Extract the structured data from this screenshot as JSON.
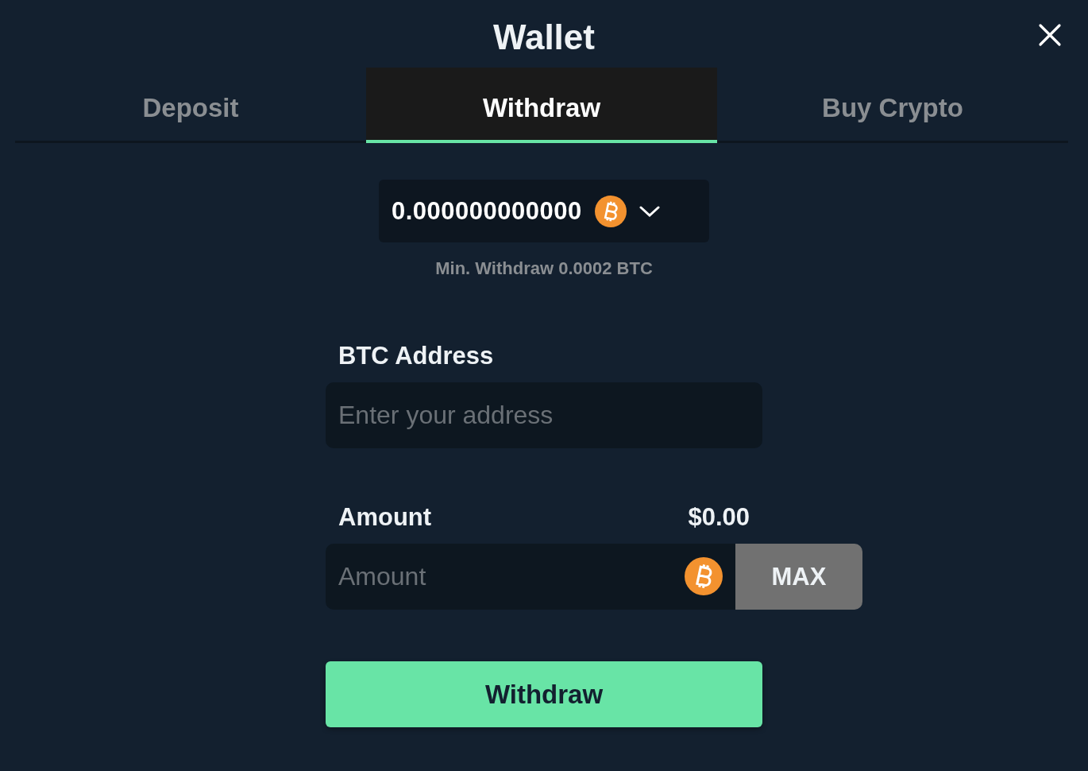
{
  "title": "Wallet",
  "tabs": [
    {
      "label": "Deposit",
      "selected": false
    },
    {
      "label": "Withdraw",
      "selected": true
    },
    {
      "label": "Buy Crypto",
      "selected": false
    }
  ],
  "balance": {
    "amount": "0.000000000000"
  },
  "min_withdraw": "Min. Withdraw 0.0002 BTC",
  "address": {
    "label": "BTC Address",
    "placeholder": "Enter your address"
  },
  "amount": {
    "label": "Amount",
    "usd": "$0.00",
    "placeholder": "Amount",
    "max_button": "MAX"
  },
  "submit": "Withdraw"
}
